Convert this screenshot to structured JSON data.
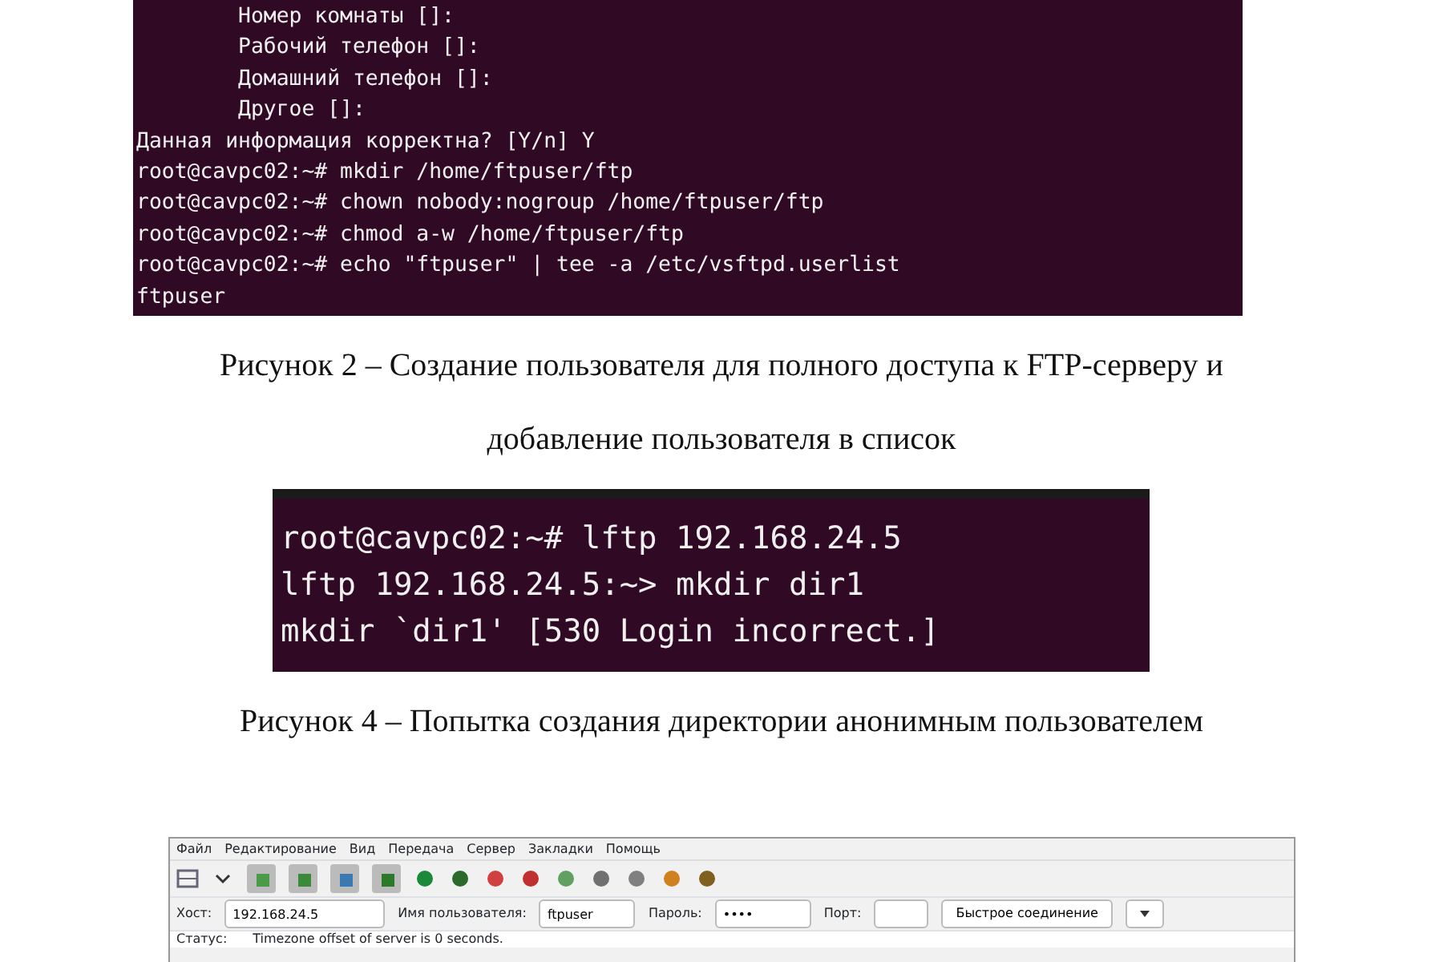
{
  "terminal_1": {
    "lines": [
      {
        "text": "        Номер комнаты []:"
      },
      {
        "text": "        Рабочий телефон []:"
      },
      {
        "text": "        Домашний телефон []:"
      },
      {
        "text": "        Другое []:"
      },
      {
        "text": "Данная информация корректна? [Y/n] Y"
      },
      {
        "text": "root@cavpc02:~# mkdir /home/ftpuser/ftp"
      },
      {
        "text": "root@cavpc02:~# chown nobody:nogroup /home/ftpuser/ftp"
      },
      {
        "text": "root@cavpc02:~# chmod a-w /home/ftpuser/ftp"
      },
      {
        "text": "root@cavpc02:~# echo \"ftpuser\" | tee -a /etc/vsftpd.userlist"
      },
      {
        "text": "ftpuser"
      }
    ]
  },
  "caption_1": [
    "Рисунок 2 – Создание пользователя для полного доступа к FTP-серверу и",
    "добавление пользователя в список"
  ],
  "terminal_2": {
    "lines": [
      {
        "text": "root@cavpc02:~# lftp 192.168.24.5"
      },
      {
        "text": "lftp 192.168.24.5:~> mkdir dir1"
      },
      {
        "text": "mkdir `dir1' [530 Login incorrect.]"
      }
    ]
  },
  "caption_2": "Рисунок 4 – Попытка создания директории анонимным пользователем",
  "ftp_client": {
    "menu": [
      "Файл",
      "Редактирование",
      "Вид",
      "Передача",
      "Сервер",
      "Закладки",
      "Помощь"
    ],
    "toolbar": [
      {
        "kind": "grid"
      },
      {
        "kind": "caret"
      },
      {
        "kind": "toggle",
        "color": "#4a9a4a"
      },
      {
        "kind": "toggle",
        "color": "#3a8a3a"
      },
      {
        "kind": "toggle",
        "color": "#3a7ab0"
      },
      {
        "kind": "toggle",
        "color": "#2a7a2a"
      },
      {
        "kind": "tool",
        "color": "#1a8a3a"
      },
      {
        "kind": "tool",
        "color": "#2a6a2a"
      },
      {
        "kind": "tool",
        "color": "#d04040"
      },
      {
        "kind": "tool",
        "color": "#c03030"
      },
      {
        "kind": "tool",
        "color": "#60a060"
      },
      {
        "kind": "tool",
        "color": "#707070"
      },
      {
        "kind": "tool",
        "color": "#808080"
      },
      {
        "kind": "tool",
        "color": "#d08020"
      },
      {
        "kind": "tool",
        "color": "#806020"
      }
    ],
    "host_label": "Хост:",
    "host": "192.168.24.5",
    "user_label": "Имя пользователя:",
    "user": "ftpuser",
    "password_label": "Пароль:",
    "password": "••••",
    "port_label": "Порт:",
    "connect_button": "Быстрое соединение",
    "log": [
      {
        "label": "Статус:",
        "text": "Timezone offset of server is 0 seconds."
      }
    ]
  }
}
